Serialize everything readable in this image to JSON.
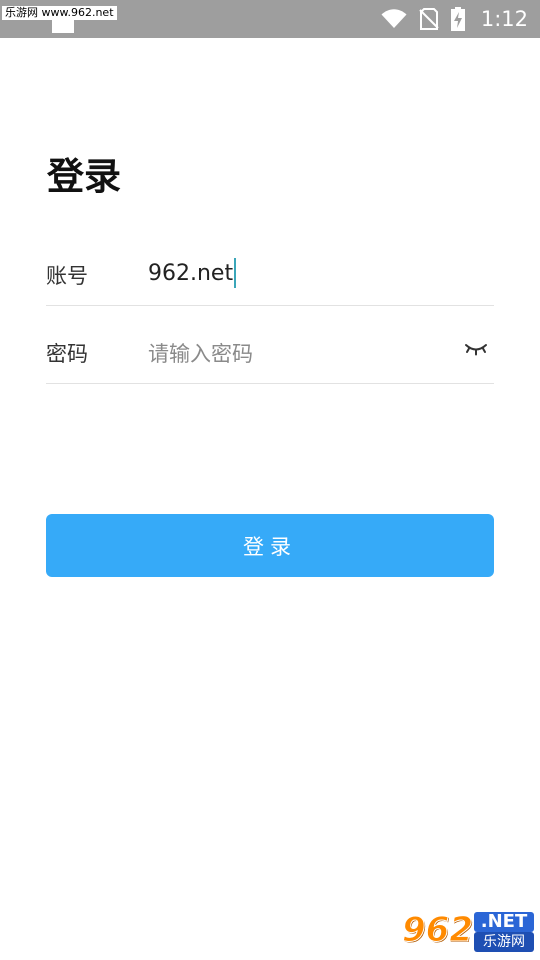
{
  "status_bar": {
    "time": "1:12",
    "icons": [
      "wifi-icon",
      "sim-no-signal-icon",
      "battery-charging-icon"
    ]
  },
  "watermark_top": "乐游网 www.962.net",
  "page": {
    "title": "登录"
  },
  "form": {
    "account_label": "账号",
    "account_value": "962.net",
    "password_label": "密码",
    "password_placeholder": "请输入密码",
    "password_toggle_icon": "eye-closed-icon"
  },
  "login_button": {
    "label": "登录"
  },
  "watermark_bottom": {
    "number": "962",
    "net": ".NET",
    "cn": "乐游网"
  },
  "colors": {
    "status_bar": "#9e9e9e",
    "accent": "#36aaf8",
    "caret": "#3aa6b9",
    "divider": "#e2e2e2"
  }
}
